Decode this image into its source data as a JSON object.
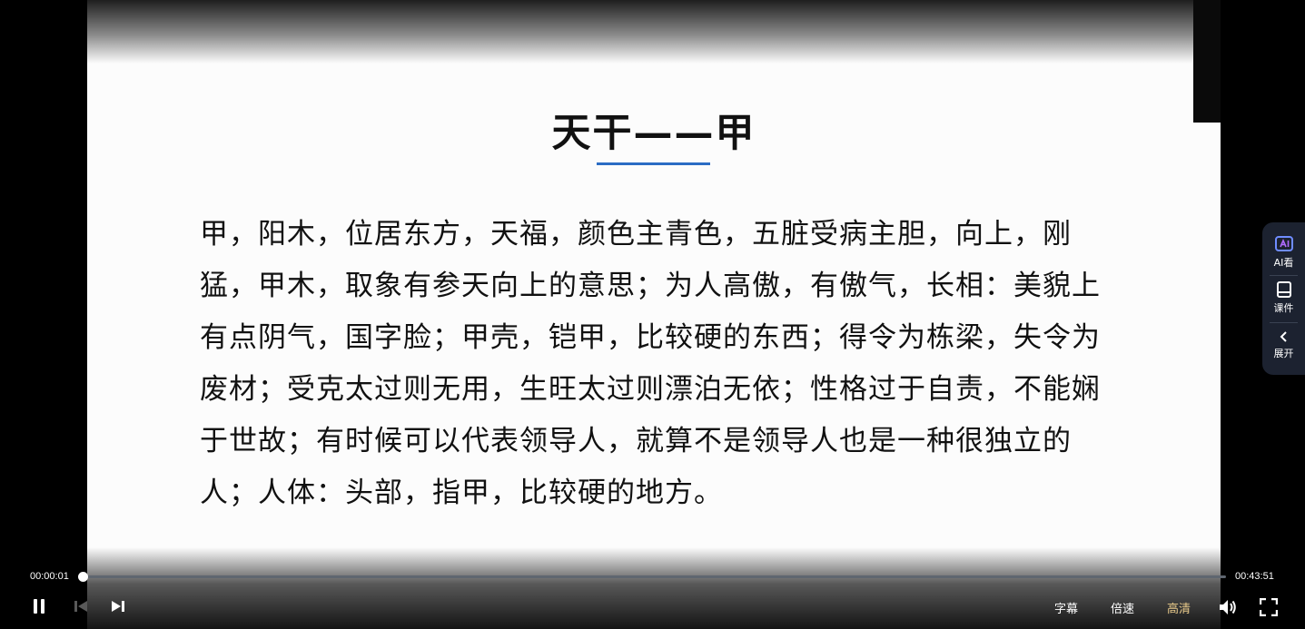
{
  "slide": {
    "title": "天干——甲",
    "body": "甲，阳木，位居东方，天福，颜色主青色，五脏受病主胆，向上，刚猛，甲木，取象有参天向上的意思；为人高傲，有傲气，长相：美貌上有点阴气，国字脸；甲壳，铠甲，比较硬的东西；得令为栋梁，失令为废材；受克太过则无用，生旺太过则漂泊无依；性格过于自责，不能娴于世故；有时候可以代表领导人，就算不是领导人也是一种很独立的人；人体：头部，指甲，比较硬的地方。",
    "accent_color": "#2b6cc4"
  },
  "player": {
    "current_time": "00:00:01",
    "total_time": "00:43:51",
    "progress_fraction": 0.0004,
    "subtitles_label": "字幕",
    "speed_label": "倍速",
    "quality_label": "高清",
    "quality_color": "#e8c98a",
    "icons": [
      "pause-icon",
      "previous-icon",
      "next-icon",
      "volume-icon",
      "fullscreen-icon"
    ]
  },
  "side_panel": {
    "ai_label": "AI看",
    "courseware_label": "课件",
    "expand_label": "展开",
    "icons": [
      "ai-watch-icon",
      "courseware-icon",
      "chevron-left-icon"
    ]
  }
}
